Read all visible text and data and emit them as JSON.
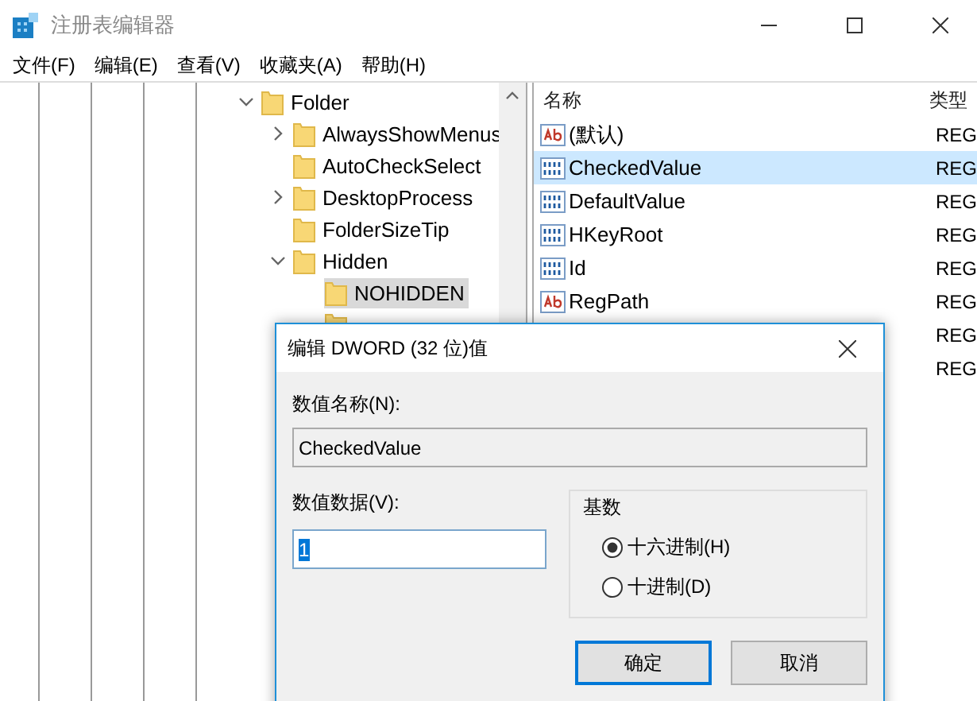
{
  "window": {
    "title": "注册表编辑器"
  },
  "menu": [
    "文件(F)",
    "编辑(E)",
    "查看(V)",
    "收藏夹(A)",
    "帮助(H)"
  ],
  "tree": [
    {
      "label": "Folder",
      "expanded": true,
      "selected": false,
      "children": [
        {
          "label": "AlwaysShowMenus",
          "expanded": false,
          "selected": false
        },
        {
          "label": "AutoCheckSelect",
          "selected": false
        },
        {
          "label": "DesktopProcess",
          "expanded": false,
          "selected": false
        },
        {
          "label": "FolderSizeTip",
          "selected": false
        },
        {
          "label": "Hidden",
          "expanded": true,
          "selected": false,
          "children": [
            {
              "label": "NOHIDDEN",
              "selected": true
            },
            {
              "selected": false
            }
          ]
        }
      ]
    }
  ],
  "values": {
    "columns": [
      "名称",
      "类型"
    ],
    "rows": [
      {
        "kind": "string",
        "name": "(默认)",
        "type": "REG",
        "selected": false
      },
      {
        "kind": "binary",
        "name": "CheckedValue",
        "type": "REG",
        "selected": true
      },
      {
        "kind": "binary",
        "name": "DefaultValue",
        "type": "REG",
        "selected": false
      },
      {
        "kind": "binary",
        "name": "HKeyRoot",
        "type": "REG",
        "selected": false
      },
      {
        "kind": "binary",
        "name": "Id",
        "type": "REG",
        "selected": false
      },
      {
        "kind": "string",
        "name": "RegPath",
        "type": "REG",
        "selected": false
      },
      {
        "kind": "hidden",
        "type": "REG",
        "selected": false
      },
      {
        "kind": "hidden",
        "type": "REG",
        "selected": false
      }
    ]
  },
  "dialog": {
    "title": "编辑 DWORD (32 位)值",
    "name_label": "数值名称(N):",
    "name_value": "CheckedValue",
    "data_label": "数值数据(V):",
    "data_value": "1",
    "base_label": "基数",
    "radios": [
      {
        "label": "十六进制(H)",
        "selected": true
      },
      {
        "label": "十进制(D)",
        "selected": false
      }
    ],
    "buttons": [
      {
        "label": "确定",
        "default": true
      },
      {
        "label": "取消",
        "default": false
      }
    ]
  }
}
